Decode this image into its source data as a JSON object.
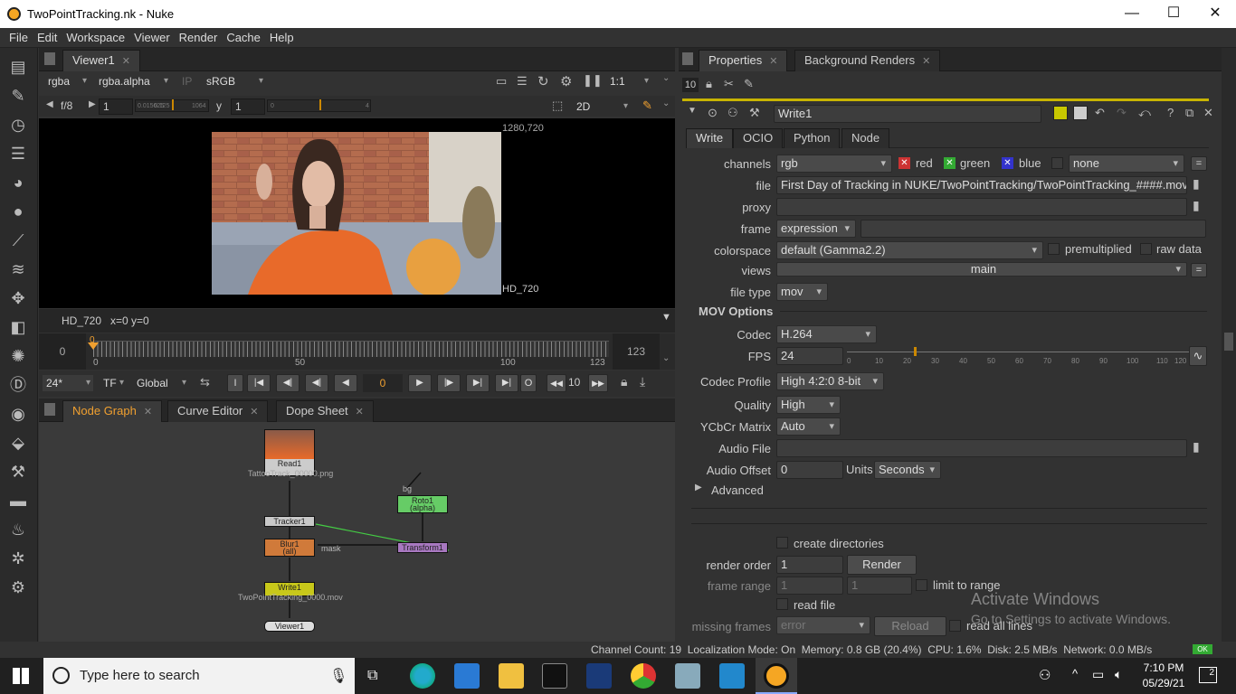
{
  "window": {
    "title": "TwoPointTracking.nk - Nuke",
    "minimize": "—",
    "maximize": "☐",
    "close": "✕"
  },
  "menu": [
    "File",
    "Edit",
    "Workspace",
    "Viewer",
    "Render",
    "Cache",
    "Help"
  ],
  "viewer": {
    "tab": "Viewer1",
    "channels": "rgba",
    "alpha": "rgba.alpha",
    "ip": "IP",
    "lut": "sRGB",
    "zoom": "1:1",
    "fstop": "f/8",
    "gain": "1",
    "gain_ticks": [
      "0.015625",
      "0.125",
      "1",
      "1064"
    ],
    "y_label": "y",
    "gamma": "1",
    "gamma_ticks": [
      "0",
      "",
      "1",
      "4"
    ],
    "mode": "2D",
    "resolution": "1280,720",
    "format": "HD_720",
    "info": "HD_720   x=0 y=0",
    "timeline": {
      "start": "0",
      "end": "123",
      "current_marker": "0",
      "ticks": [
        "0",
        "50",
        "100",
        "123"
      ]
    },
    "fps": "24*",
    "tf": "TF",
    "global": "Global",
    "frame": "0",
    "step": "10"
  },
  "nodegraph": {
    "tabs": [
      "Node Graph",
      "Curve Editor",
      "Dope Sheet"
    ],
    "nodes": {
      "read": {
        "name": "Read1",
        "label": "TattooTrack_00000.png"
      },
      "tracker": {
        "name": "Tracker1"
      },
      "blur": {
        "name": "Blur1",
        "label": "(all)"
      },
      "write": {
        "name": "Write1",
        "label": "TwoPointTracking_0000.mov"
      },
      "viewer": {
        "name": "Viewer1"
      },
      "roto": {
        "name": "Roto1",
        "label": "(alpha)"
      },
      "transform": {
        "name": "Transform1"
      },
      "mask_label": "mask",
      "bg_label": "bg"
    }
  },
  "properties": {
    "tabs": [
      "Properties",
      "Background Renders"
    ],
    "max_panels": "10",
    "node_name": "Write1",
    "subtabs": [
      "Write",
      "OCIO",
      "Python",
      "Node"
    ],
    "channels_label": "channels",
    "channels_value": "rgb",
    "ch_red": "red",
    "ch_green": "green",
    "ch_blue": "blue",
    "ch_none": "none",
    "file_label": "file",
    "file_value": "First Day of Tracking in NUKE/TwoPointTracking/TwoPointTracking_####.mov",
    "proxy_label": "proxy",
    "frame_label": "frame",
    "frame_value": "expression",
    "colorspace_label": "colorspace",
    "colorspace_value": "default (Gamma2.2)",
    "premult": "premultiplied",
    "rawdata": "raw data",
    "views_label": "views",
    "views_value": "main",
    "filetype_label": "file type",
    "filetype_value": "mov",
    "mov_header": "MOV Options",
    "codec_label": "Codec",
    "codec_value": "H.264",
    "fps_label": "FPS",
    "fps_value": "24",
    "fps_ticks": [
      "0",
      "10",
      "20",
      "30",
      "40",
      "50",
      "60",
      "70",
      "80",
      "90",
      "100",
      "110",
      "120"
    ],
    "profile_label": "Codec Profile",
    "profile_value": "High 4:2:0 8-bit",
    "quality_label": "Quality",
    "quality_value": "High",
    "ycbcr_label": "YCbCr Matrix",
    "ycbcr_value": "Auto",
    "audiofile_label": "Audio File",
    "audiooffset_label": "Audio Offset",
    "audiooffset_value": "0",
    "units_label": "Units",
    "units_value": "Seconds",
    "advanced": "Advanced",
    "createdirs": "create directories",
    "renderorder_label": "render order",
    "renderorder_value": "1",
    "render_btn": "Render",
    "framerange_label": "frame range",
    "fr_start": "1",
    "fr_end": "1",
    "limit": "limit to range",
    "readfile": "read file",
    "missing_label": "missing frames",
    "missing_value": "error",
    "reload_btn": "Reload",
    "readlines": "read all lines"
  },
  "watermark": {
    "title": "Activate Windows",
    "sub": "Go to Settings to activate Windows."
  },
  "status": {
    "text": "Channel Count: 19  Localization Mode: On  Memory: 0.8 GB (20.4%)  CPU: 1.6%  Disk: 2.5 MB/s  Network: 0.0 MB/s",
    "ok": "OK"
  },
  "taskbar": {
    "search": "Type here to search",
    "time": "7:10 PM",
    "date": "05/29/21",
    "notif": "2"
  }
}
